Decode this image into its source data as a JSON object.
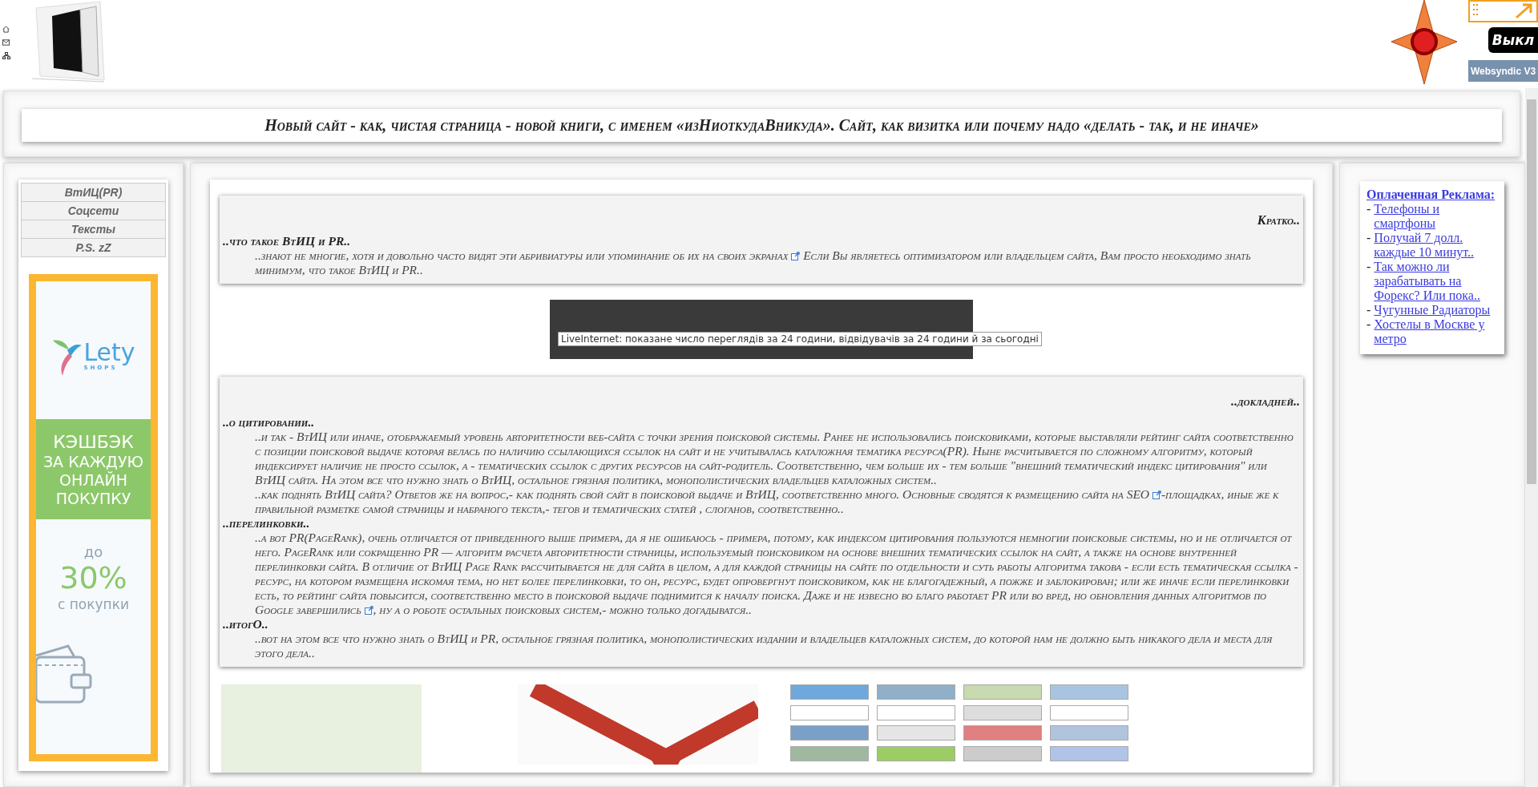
{
  "header": {
    "nav_icons": [
      {
        "kind": "home"
      },
      {
        "kind": "mail"
      },
      {
        "kind": "sitemap"
      }
    ],
    "toggle_button": "Выкл",
    "badge": "Websyndic V3"
  },
  "title": "Новый сайт - как, чистая страница - новой книги, с именем «изНиоткудаВникуда». Сайт, как визитка или почему надо «делать - так, и не иначе»",
  "sidebar": {
    "menu": [
      {
        "label": "ВтИЦ(PR)"
      },
      {
        "label": "Соцсети"
      },
      {
        "label": "Тексты"
      },
      {
        "label": "P.S. zZ"
      }
    ],
    "banner": {
      "brand": "Lety",
      "brand_sub": "SHOPS",
      "headline_lines": [
        "КЭШБЭК",
        "ЗА КАЖДУЮ",
        "ОНЛАЙН",
        "ПОКУПКУ"
      ],
      "prefix": "до",
      "percent": "30%",
      "suffix": "с покупки"
    }
  },
  "articles": [
    {
      "heading": "Кратко..",
      "sections": [
        {
          "title": "..что такое ВтИЦ и PR..",
          "paragraphs": [
            [
              {
                "kind": "text",
                "text": "..знают не многие, хотя и довольно часто видят эти абривиатуры или упоминание об их на своих экранах "
              },
              {
                "kind": "link-icon"
              },
              {
                "kind": "text",
                "text": " Если Вы являетесь оптимизатором или владельцем сайта, Вам просто необходимо знать минимум, что такое ВтИЦ и PR.."
              }
            ]
          ]
        }
      ]
    },
    {
      "heading": "..докладней..",
      "sections": [
        {
          "title": "..о цитировании..",
          "paragraphs": [
            [
              {
                "kind": "text",
                "text": "..и так - ВтИЦ или иначе, отображаемый уровень авторитетности веб-сайта с точки зрения поисковой системы. Ранее не использовались поисковиками, которые выставляли рейтинг сайта соответственно с позиции поисковой выдаче которая велась по наличию ссылающихся ссылок на сайт и не учитывалась каталожная тематика ресурса(PR). Ныне расчитывается по сложному алгоритму, который индексирует наличие не просто ссылок, а - тематических ссылок с других ресурсов на сайт-родитель. Соответственно, чем больше их - тем больше \"внешний тематический индекс цитирования\" или ВтИЦ сайта. На этом все что нужно знать о ВтИЦ, остальное грязная политика, монополистических владельцев каталожных систем.."
              }
            ],
            [
              {
                "kind": "text",
                "text": "..как поднять ВтИЦ сайта? Ответов же на вопрос,- как поднять свой сайт в поисковой выдаче и ВтИЦ, соответственно много. Основные сводятся к размещению сайта на SEO "
              },
              {
                "kind": "link-icon"
              },
              {
                "kind": "text",
                "text": "-площадках, иные же к правильной разметке самой страницы и набраного текста,- тегов и тематических статей , слоганов, соответственно.."
              }
            ]
          ]
        },
        {
          "title": "..перелинковки..",
          "paragraphs": [
            [
              {
                "kind": "text",
                "text": "..а вот PR(PageRank), очень отличается от приведенного выше примера, да я не ошибаюсь - примера, потому, как индексом цитирования пользуются немногии поисковые системы, но и не отличается от него. PageRank или сокращенно PR — алгоритм расчета авторитетности страницы, используемый поисковиком на основе внешних тематических ссылок на сайт, а также на основе внутренней перелинковки сайта. В отличие от ВтИЦ Page Rank рассчитывается не для сайта в целом, а для каждой страницы на сайте по отдельности и суть работы алгоритма такова - если есть тематическая ссылка - ресурс, на котором размещена искомая тема, но нет более перелинковки, то он, ресурс, будет опровергнут поисковиком, как не благогадежный, а пожже и заблокирован; или же иначе если перелинковки есть, то рейтинг сайта повысится, соответственно место в поисковой выдаче поднимится к началу поиска. Даже и не извесно во благо работает PR или во вред, но обновления данных алгоритмов по Google завершились "
              },
              {
                "kind": "link-icon"
              },
              {
                "kind": "text",
                "text": ", ну а о роботе остальных поисковых систем,- можно только догадыватся.."
              }
            ]
          ]
        },
        {
          "title": "..итогО..",
          "paragraphs": [
            [
              {
                "kind": "text",
                "text": "..вот на этом все что нужно знать о ВтИЦ и PR, остальное грязная политика, монополистических издании и владельцев каталожных систем, до которой нам не должно быть никакого дела и места для этого дела.."
              }
            ]
          ]
        }
      ]
    }
  ],
  "counter_tooltip": "LiveInternet: показане число переглядів за 24 години, відвідувачів за 24 години й за сьогодні",
  "ads": {
    "title": "Оплаченная Реклама:",
    "items": [
      {
        "prefix": "-",
        "label": "Телефоны и смартфоны"
      },
      {
        "prefix": "-",
        "label": "Получай 7 долл. каждые 10 минут.."
      },
      {
        "prefix": "-",
        "label": "Так можно ли зарабатывать на Форекс? Или пока.."
      },
      {
        "prefix": "-",
        "label": "Чугунные Радиаторы"
      },
      {
        "prefix": "-",
        "label": "Хостелы в Москве у метро"
      }
    ]
  }
}
